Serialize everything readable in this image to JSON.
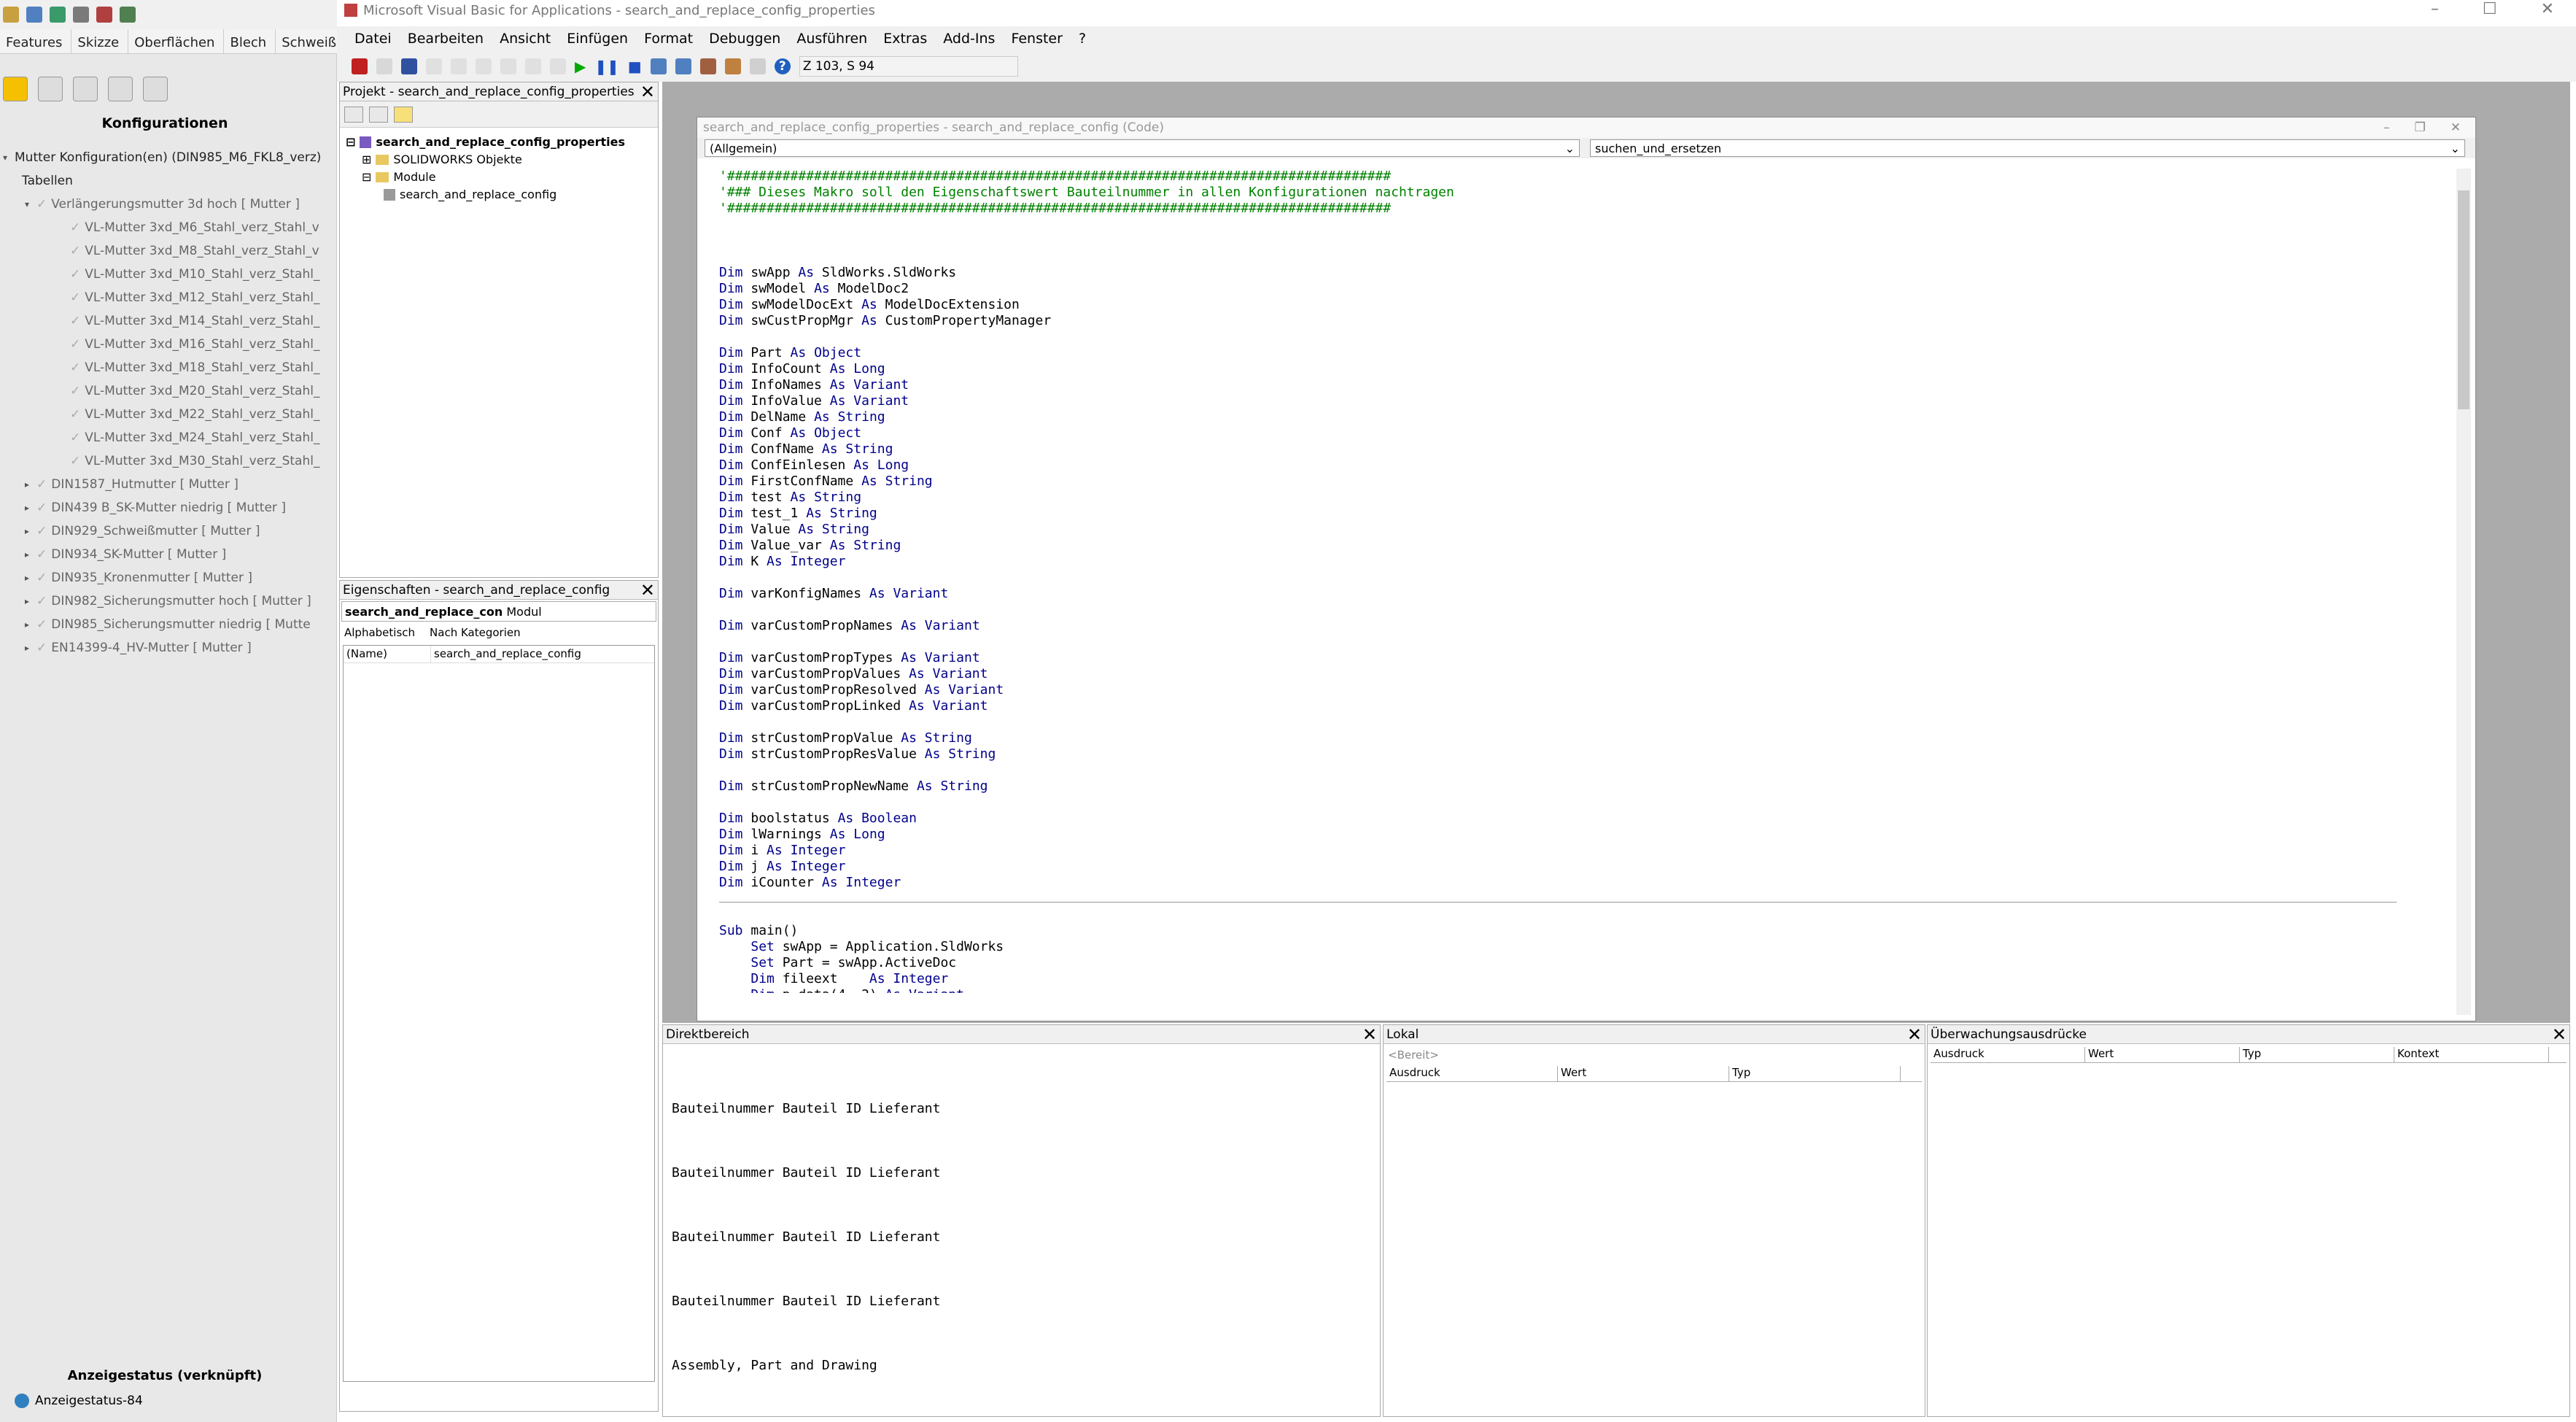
{
  "solidworks": {
    "tabs": [
      "Features",
      "Skizze",
      "Oberflächen",
      "Blech",
      "Schweißkonstrukt"
    ],
    "panel_title": "Konfigurationen",
    "root": "Mutter Konfiguration(en)  (DIN985_M6_FKL8_verz)",
    "tables": "Tabellen",
    "items": [
      "Verlängerungsmutter 3d hoch [ Mutter ]",
      "VL-Mutter 3xd_M6_Stahl_verz_Stahl_v",
      "VL-Mutter 3xd_M8_Stahl_verz_Stahl_v",
      "VL-Mutter 3xd_M10_Stahl_verz_Stahl_",
      "VL-Mutter 3xd_M12_Stahl_verz_Stahl_",
      "VL-Mutter 3xd_M14_Stahl_verz_Stahl_",
      "VL-Mutter 3xd_M16_Stahl_verz_Stahl_",
      "VL-Mutter 3xd_M18_Stahl_verz_Stahl_",
      "VL-Mutter 3xd_M20_Stahl_verz_Stahl_",
      "VL-Mutter 3xd_M22_Stahl_verz_Stahl_",
      "VL-Mutter 3xd_M24_Stahl_verz_Stahl_",
      "VL-Mutter 3xd_M30_Stahl_verz_Stahl_",
      "DIN1587_Hutmutter [ Mutter ]",
      "DIN439 B_SK-Mutter niedrig [ Mutter ]",
      "DIN929_Schweißmutter [ Mutter ]",
      "DIN934_SK-Mutter [ Mutter ]",
      "DIN935_Kronenmutter [ Mutter ]",
      "DIN982_Sicherungsmutter hoch [ Mutter ]",
      "DIN985_Sicherungsmutter niedrig [ Mutte",
      "EN14399-4_HV-Mutter [ Mutter ]"
    ],
    "display_state_title": "Anzeigestatus (verknüpft)",
    "display_state": "Anzeigestatus-84"
  },
  "vba": {
    "title": "Microsoft Visual Basic for Applications - search_and_replace_config_properties",
    "menu": [
      "Datei",
      "Bearbeiten",
      "Ansicht",
      "Einfügen",
      "Format",
      "Debuggen",
      "Ausführen",
      "Extras",
      "Add-Ins",
      "Fenster",
      "?"
    ],
    "position": "Z 103, S 94",
    "project": {
      "title": "Projekt - search_and_replace_config_properties",
      "root": "search_and_replace_config_properties",
      "objects": "SOLIDWORKS Objekte",
      "modules": "Module",
      "module": "search_and_replace_config"
    },
    "properties": {
      "title": "Eigenschaften - search_and_replace_config",
      "select_name": "search_and_replace_con",
      "select_type": "Modul",
      "tab_alpha": "Alphabetisch",
      "tab_cat": "Nach Kategorien",
      "row_key": "(Name)",
      "row_val": "search_and_replace_config"
    },
    "code_window": {
      "title": "search_and_replace_config_properties - search_and_replace_config (Code)",
      "object_dd": "(Allgemein)",
      "proc_dd": "suchen_und_ersetzen"
    },
    "direkt": {
      "title": "Direktbereich",
      "lines": [
        "Bauteilnummer Bauteil ID Lieferant",
        "Bauteilnummer Bauteil ID Lieferant",
        "Bauteilnummer Bauteil ID Lieferant",
        "Bauteilnummer Bauteil ID Lieferant",
        "Assembly, Part and Drawing"
      ]
    },
    "lokal": {
      "title": "Lokal",
      "ready": "<Bereit>",
      "cols": [
        "Ausdruck",
        "Wert",
        "Typ"
      ]
    },
    "watch": {
      "title": "Überwachungsausdrücke",
      "cols": [
        "Ausdruck",
        "Wert",
        "Typ",
        "Kontext"
      ]
    }
  }
}
